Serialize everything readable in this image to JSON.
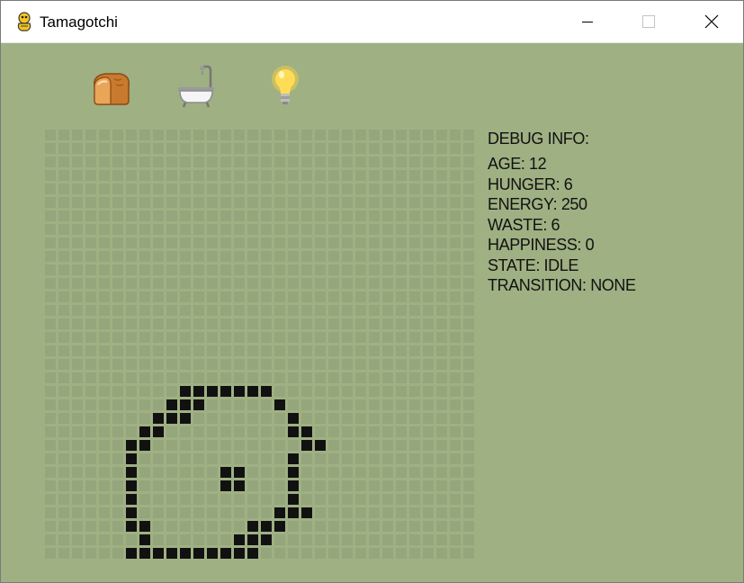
{
  "window": {
    "title": "Tamagotchi",
    "icon": "python-snake-icon"
  },
  "titlebar_buttons": [
    "minimize-icon",
    "maximize-icon",
    "close-icon"
  ],
  "actions": [
    {
      "name": "feed",
      "icon": "bread-icon"
    },
    {
      "name": "clean",
      "icon": "bathtub-icon"
    },
    {
      "name": "light",
      "icon": "light-bulb-icon"
    }
  ],
  "debug": {
    "header": "DEBUG INFO:",
    "lines": [
      "AGE: 12",
      "HUNGER: 6",
      "ENERGY: 250",
      "WASTE: 6",
      "HAPPINESS: 0",
      "STATE: IDLE",
      "TRANSITION: NONE"
    ]
  },
  "screen": {
    "columns": 32,
    "rows": 32,
    "on_color": "#111111",
    "off_color": "#95a67c",
    "background": "#9fb083",
    "pixels": [
      "................................",
      "................................",
      "................................",
      "................................",
      "................................",
      "................................",
      "................................",
      "................................",
      "................................",
      "................................",
      "................................",
      "................................",
      "................................",
      "................................",
      "................................",
      "................................",
      "................................",
      "................................",
      "................................",
      "..........#######...............",
      ".........###.....#..............",
      "........###.......#.............",
      ".......##.........##............",
      "......##...........##...........",
      "......#...........#.............",
      "......#......##...#.............",
      "......#......##...#.............",
      "......#...........#.............",
      "......#..........###............",
      "......##.......###..............",
      ".......#......###...............",
      "......##########................"
    ]
  }
}
